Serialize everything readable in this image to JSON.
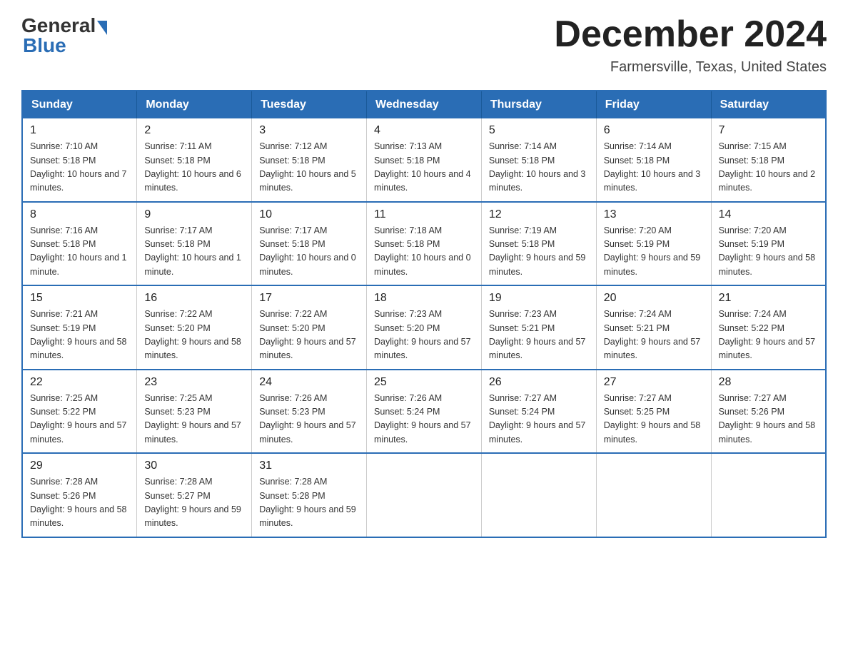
{
  "header": {
    "logo": {
      "general_text": "General",
      "blue_text": "Blue"
    },
    "title": "December 2024",
    "subtitle": "Farmersville, Texas, United States"
  },
  "calendar": {
    "days_of_week": [
      "Sunday",
      "Monday",
      "Tuesday",
      "Wednesday",
      "Thursday",
      "Friday",
      "Saturday"
    ],
    "weeks": [
      [
        {
          "day": "1",
          "sunrise": "7:10 AM",
          "sunset": "5:18 PM",
          "daylight": "10 hours and 7 minutes."
        },
        {
          "day": "2",
          "sunrise": "7:11 AM",
          "sunset": "5:18 PM",
          "daylight": "10 hours and 6 minutes."
        },
        {
          "day": "3",
          "sunrise": "7:12 AM",
          "sunset": "5:18 PM",
          "daylight": "10 hours and 5 minutes."
        },
        {
          "day": "4",
          "sunrise": "7:13 AM",
          "sunset": "5:18 PM",
          "daylight": "10 hours and 4 minutes."
        },
        {
          "day": "5",
          "sunrise": "7:14 AM",
          "sunset": "5:18 PM",
          "daylight": "10 hours and 3 minutes."
        },
        {
          "day": "6",
          "sunrise": "7:14 AM",
          "sunset": "5:18 PM",
          "daylight": "10 hours and 3 minutes."
        },
        {
          "day": "7",
          "sunrise": "7:15 AM",
          "sunset": "5:18 PM",
          "daylight": "10 hours and 2 minutes."
        }
      ],
      [
        {
          "day": "8",
          "sunrise": "7:16 AM",
          "sunset": "5:18 PM",
          "daylight": "10 hours and 1 minute."
        },
        {
          "day": "9",
          "sunrise": "7:17 AM",
          "sunset": "5:18 PM",
          "daylight": "10 hours and 1 minute."
        },
        {
          "day": "10",
          "sunrise": "7:17 AM",
          "sunset": "5:18 PM",
          "daylight": "10 hours and 0 minutes."
        },
        {
          "day": "11",
          "sunrise": "7:18 AM",
          "sunset": "5:18 PM",
          "daylight": "10 hours and 0 minutes."
        },
        {
          "day": "12",
          "sunrise": "7:19 AM",
          "sunset": "5:18 PM",
          "daylight": "9 hours and 59 minutes."
        },
        {
          "day": "13",
          "sunrise": "7:20 AM",
          "sunset": "5:19 PM",
          "daylight": "9 hours and 59 minutes."
        },
        {
          "day": "14",
          "sunrise": "7:20 AM",
          "sunset": "5:19 PM",
          "daylight": "9 hours and 58 minutes."
        }
      ],
      [
        {
          "day": "15",
          "sunrise": "7:21 AM",
          "sunset": "5:19 PM",
          "daylight": "9 hours and 58 minutes."
        },
        {
          "day": "16",
          "sunrise": "7:22 AM",
          "sunset": "5:20 PM",
          "daylight": "9 hours and 58 minutes."
        },
        {
          "day": "17",
          "sunrise": "7:22 AM",
          "sunset": "5:20 PM",
          "daylight": "9 hours and 57 minutes."
        },
        {
          "day": "18",
          "sunrise": "7:23 AM",
          "sunset": "5:20 PM",
          "daylight": "9 hours and 57 minutes."
        },
        {
          "day": "19",
          "sunrise": "7:23 AM",
          "sunset": "5:21 PM",
          "daylight": "9 hours and 57 minutes."
        },
        {
          "day": "20",
          "sunrise": "7:24 AM",
          "sunset": "5:21 PM",
          "daylight": "9 hours and 57 minutes."
        },
        {
          "day": "21",
          "sunrise": "7:24 AM",
          "sunset": "5:22 PM",
          "daylight": "9 hours and 57 minutes."
        }
      ],
      [
        {
          "day": "22",
          "sunrise": "7:25 AM",
          "sunset": "5:22 PM",
          "daylight": "9 hours and 57 minutes."
        },
        {
          "day": "23",
          "sunrise": "7:25 AM",
          "sunset": "5:23 PM",
          "daylight": "9 hours and 57 minutes."
        },
        {
          "day": "24",
          "sunrise": "7:26 AM",
          "sunset": "5:23 PM",
          "daylight": "9 hours and 57 minutes."
        },
        {
          "day": "25",
          "sunrise": "7:26 AM",
          "sunset": "5:24 PM",
          "daylight": "9 hours and 57 minutes."
        },
        {
          "day": "26",
          "sunrise": "7:27 AM",
          "sunset": "5:24 PM",
          "daylight": "9 hours and 57 minutes."
        },
        {
          "day": "27",
          "sunrise": "7:27 AM",
          "sunset": "5:25 PM",
          "daylight": "9 hours and 58 minutes."
        },
        {
          "day": "28",
          "sunrise": "7:27 AM",
          "sunset": "5:26 PM",
          "daylight": "9 hours and 58 minutes."
        }
      ],
      [
        {
          "day": "29",
          "sunrise": "7:28 AM",
          "sunset": "5:26 PM",
          "daylight": "9 hours and 58 minutes."
        },
        {
          "day": "30",
          "sunrise": "7:28 AM",
          "sunset": "5:27 PM",
          "daylight": "9 hours and 59 minutes."
        },
        {
          "day": "31",
          "sunrise": "7:28 AM",
          "sunset": "5:28 PM",
          "daylight": "9 hours and 59 minutes."
        },
        null,
        null,
        null,
        null
      ]
    ]
  }
}
